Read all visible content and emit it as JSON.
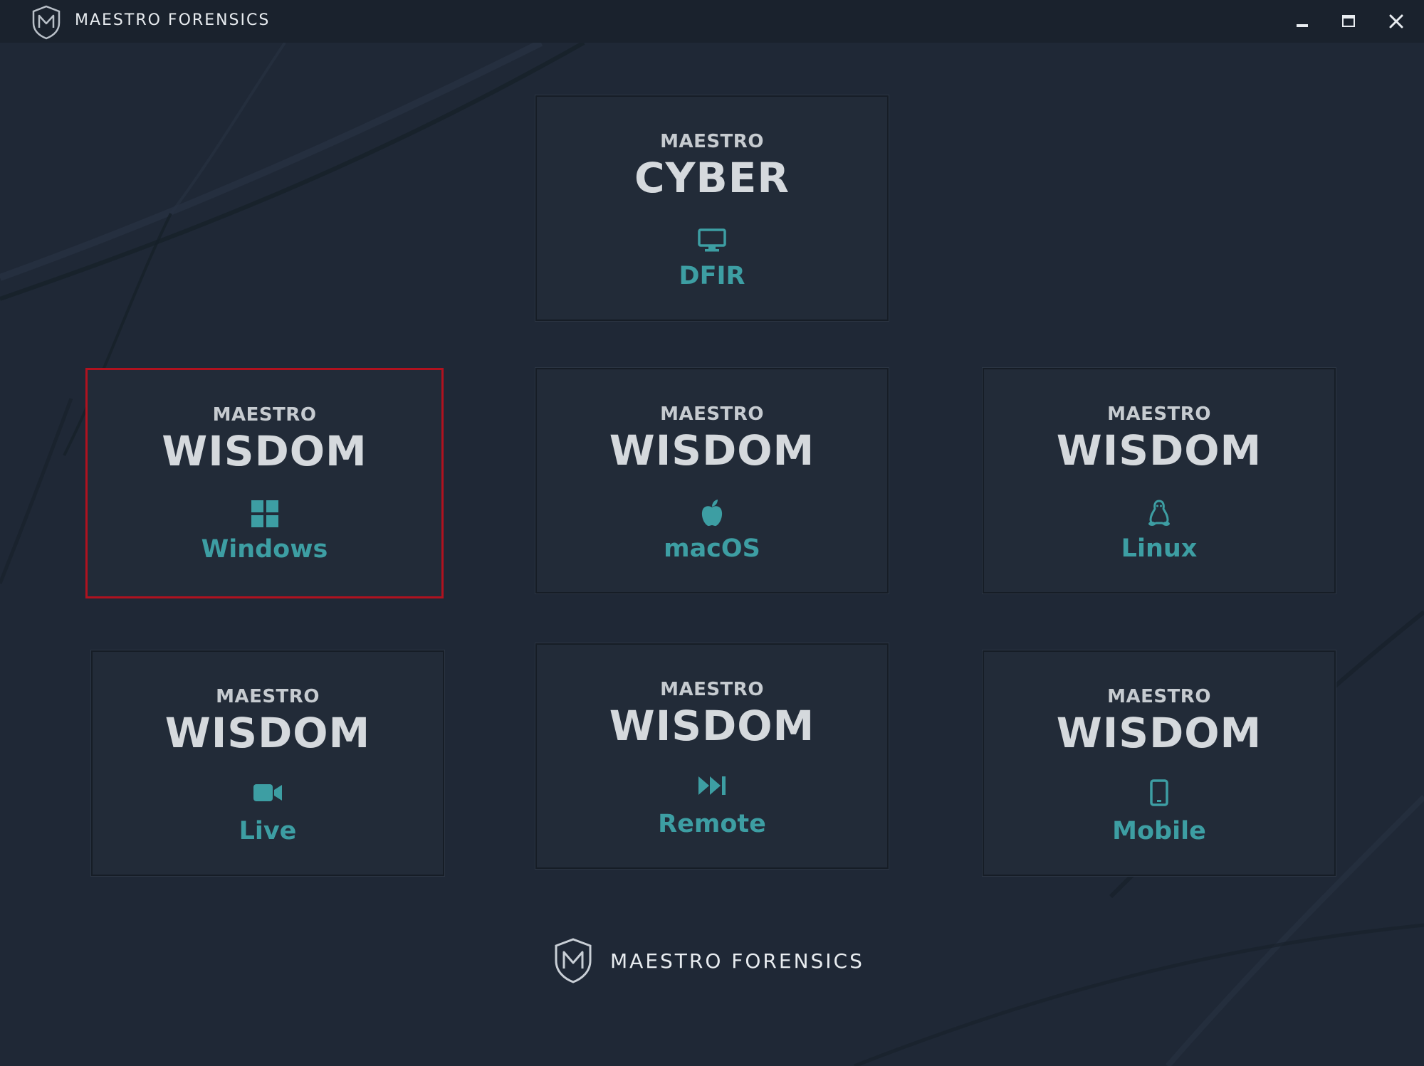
{
  "window": {
    "title": "MAESTRO FORENSICS",
    "controls": {
      "minimize_icon": "minimize-icon",
      "maximize_icon": "maximize-icon",
      "close_icon": "close-icon"
    }
  },
  "colors": {
    "background": "#1f2836",
    "tile_background": "#222b38",
    "accent": "#3d9ea3",
    "selected_border": "#b0121f",
    "text_primary": "#d5d9dd"
  },
  "tiles": [
    {
      "brand": "MAESTRO",
      "product": "CYBER",
      "subtitle": "DFIR",
      "icon": "monitor-icon",
      "selected": false
    },
    {
      "brand": "MAESTRO",
      "product": "WISDOM",
      "subtitle": "Windows",
      "icon": "windows-icon",
      "selected": true
    },
    {
      "brand": "MAESTRO",
      "product": "WISDOM",
      "subtitle": "macOS",
      "icon": "apple-icon",
      "selected": false
    },
    {
      "brand": "MAESTRO",
      "product": "WISDOM",
      "subtitle": "Linux",
      "icon": "linux-icon",
      "selected": false
    },
    {
      "brand": "MAESTRO",
      "product": "WISDOM",
      "subtitle": "Live",
      "icon": "video-camera-icon",
      "selected": false
    },
    {
      "brand": "MAESTRO",
      "product": "WISDOM",
      "subtitle": "Remote",
      "icon": "fast-forward-icon",
      "selected": false
    },
    {
      "brand": "MAESTRO",
      "product": "WISDOM",
      "subtitle": "Mobile",
      "icon": "mobile-phone-icon",
      "selected": false
    }
  ],
  "footer": {
    "brand": "MAESTRO FORENSICS",
    "logo_icon": "shield-logo-icon"
  }
}
